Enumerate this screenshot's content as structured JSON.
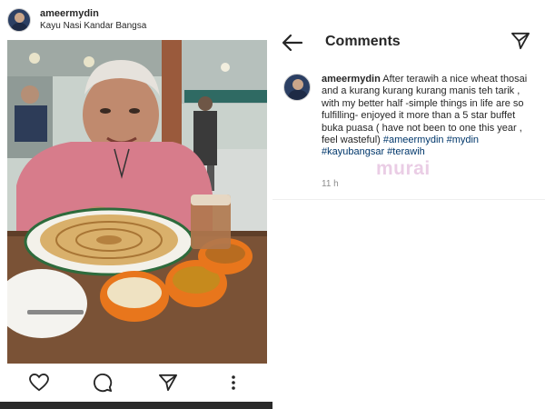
{
  "post": {
    "username": "ameermydin",
    "location": "Kayu Nasi Kandar Bangsa",
    "actions": {
      "like_icon": "heart-icon",
      "comment_icon": "speech-bubble-icon",
      "share_icon": "paper-plane-icon",
      "more_icon": "vertical-dots-icon"
    }
  },
  "comments_panel": {
    "title": "Comments",
    "back_icon": "back-arrow-icon",
    "share_icon": "paper-plane-icon",
    "comment": {
      "username": "ameermydin",
      "text": "After terawih a nice wheat thosai and a kurang kurang kurang manis teh tarik , with my better half -simple things in life are so fulfilling- enjoyed it more than a 5 star buffet buka puasa ( have not been to one this year , feel wasteful)",
      "hashtags": [
        "#ameermydin",
        "#mydin",
        "#kayubangsar",
        "#terawih"
      ],
      "time": "11 h"
    },
    "watermark": "murai"
  },
  "colors": {
    "link": "#00376b",
    "text": "#262626",
    "muted": "#8e8e8e",
    "watermark": "#d9a5d1"
  }
}
